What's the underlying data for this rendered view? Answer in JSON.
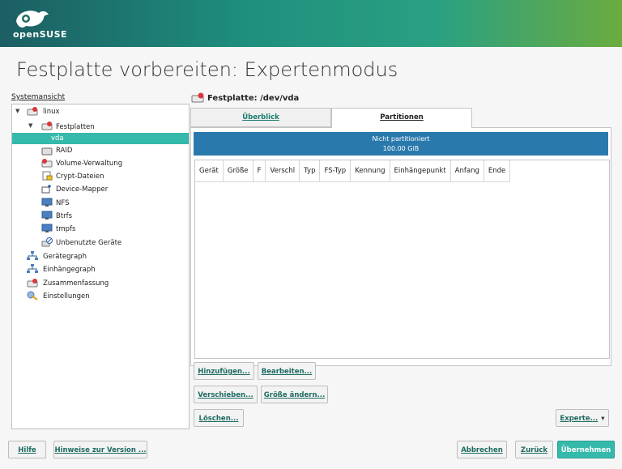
{
  "header": {
    "logo_text": "openSUSE"
  },
  "page_title": "Festplatte vorbereiten: Expertenmodus",
  "tree": {
    "label": "Systemansicht",
    "items": [
      {
        "label": "linux"
      },
      {
        "label": "Festplatten"
      },
      {
        "label": "vda"
      },
      {
        "label": "RAID"
      },
      {
        "label": "Volume-Verwaltung"
      },
      {
        "label": "Crypt-Dateien"
      },
      {
        "label": "Device-Mapper"
      },
      {
        "label": "NFS"
      },
      {
        "label": "Btrfs"
      },
      {
        "label": "tmpfs"
      },
      {
        "label": "Unbenutzte Geräte"
      },
      {
        "label": "Gerätegraph"
      },
      {
        "label": "Einhängegraph"
      },
      {
        "label": "Zusammenfassung"
      },
      {
        "label": "Einstellungen"
      }
    ]
  },
  "disk_label": "Festplatte: /dev/vda",
  "tabs": [
    {
      "label": "Überblick"
    },
    {
      "label": "Partitionen"
    }
  ],
  "bar": {
    "line1": "Nicht partitioniert",
    "line2": "100.00 GiB"
  },
  "table": {
    "columns": [
      "Gerät",
      "Größe",
      "F",
      "Verschl",
      "Typ",
      "FS-Typ",
      "Kennung",
      "Einhängepunkt",
      "Anfang",
      "Ende"
    ]
  },
  "actions": {
    "add": "Hinzufügen...",
    "edit": "Bearbeiten...",
    "move": "Verschieben...",
    "resize": "Größe ändern...",
    "delete": "Löschen...",
    "expert": "Experte..."
  },
  "footer": {
    "help": "Hilfe",
    "release_notes": "Hinweise zur Version ...",
    "abort": "Abbrechen",
    "back": "Zurück",
    "accept": "Übernehmen"
  },
  "colors": {
    "accent": "#35b9ab",
    "bar": "#2a79ad"
  }
}
